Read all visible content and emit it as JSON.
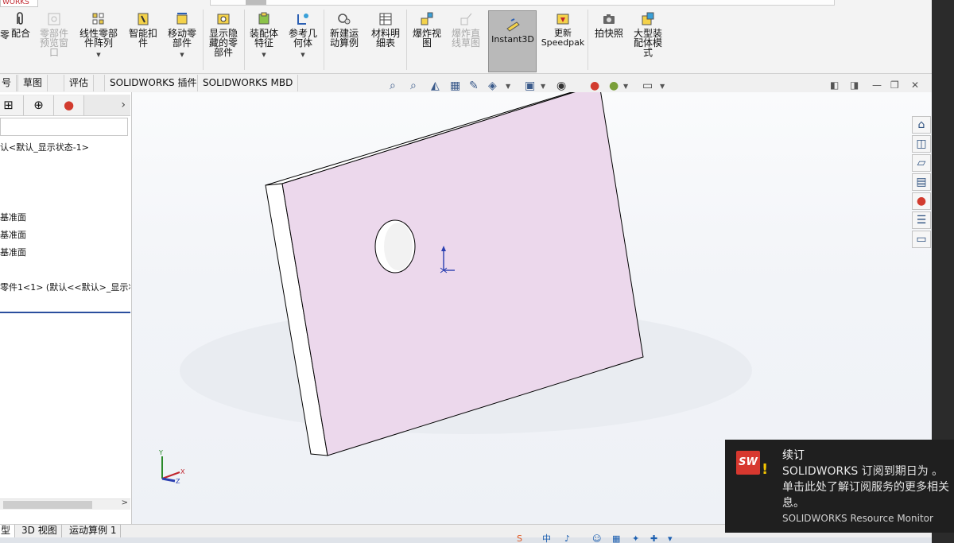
{
  "app": {
    "title_fragment": "WORKS"
  },
  "ribbon": {
    "cut_label": "零",
    "buttons": [
      {
        "key": "mate",
        "label": "配合",
        "disabled": false,
        "dropdown": false,
        "icon": "paperclip-icon"
      },
      {
        "key": "component-preview",
        "label": "零部件\n预览窗\n口",
        "disabled": true,
        "dropdown": false,
        "icon": "preview-window-icon"
      },
      {
        "key": "linear-pattern",
        "label": "线性零部\n件阵列",
        "disabled": false,
        "dropdown": true,
        "icon": "linear-pattern-icon"
      },
      {
        "key": "smart-fasteners",
        "label": "智能扣\n件",
        "disabled": false,
        "dropdown": false,
        "icon": "smart-fastener-icon"
      },
      {
        "key": "move-component",
        "label": "移动零\n部件",
        "disabled": false,
        "dropdown": true,
        "icon": "move-component-icon"
      },
      {
        "key": "show-hidden",
        "label": "显示隐\n藏的零\n部件",
        "disabled": false,
        "dropdown": false,
        "icon": "show-hidden-icon"
      },
      {
        "key": "assembly-features",
        "label": "装配体\n特征",
        "disabled": false,
        "dropdown": true,
        "icon": "assembly-feature-icon"
      },
      {
        "key": "reference-geometry",
        "label": "参考几\n何体",
        "disabled": false,
        "dropdown": true,
        "icon": "reference-geometry-icon"
      },
      {
        "key": "new-motion-study",
        "label": "新建运\n动算例",
        "disabled": false,
        "dropdown": false,
        "icon": "motion-study-icon"
      },
      {
        "key": "bill-of-materials",
        "label": "材料明\n细表",
        "disabled": false,
        "dropdown": false,
        "icon": "bom-icon"
      },
      {
        "key": "exploded-view",
        "label": "爆炸视\n图",
        "disabled": false,
        "dropdown": false,
        "icon": "exploded-view-icon"
      },
      {
        "key": "explode-line-sketch",
        "label": "爆炸直\n线草图",
        "disabled": true,
        "dropdown": false,
        "icon": "explode-line-icon"
      },
      {
        "key": "instant3d",
        "label": "Instant3D",
        "disabled": false,
        "dropdown": false,
        "icon": "instant3d-icon"
      },
      {
        "key": "update-speedpak",
        "label": "更新\nSpeedpak",
        "disabled": false,
        "dropdown": false,
        "icon": "speedpak-icon"
      },
      {
        "key": "take-snapshot",
        "label": "拍快照",
        "disabled": false,
        "dropdown": false,
        "icon": "camera-icon"
      },
      {
        "key": "large-assembly-mode",
        "label": "大型装\n配体模\n式",
        "disabled": false,
        "dropdown": false,
        "icon": "large-assembly-icon"
      }
    ]
  },
  "command_tabs": [
    {
      "label": "号"
    },
    {
      "label": "草图"
    },
    {
      "label": "评估"
    },
    {
      "label": "SOLIDWORKS 插件"
    },
    {
      "label": "SOLIDWORKS MBD"
    }
  ],
  "feature_tree": {
    "root_label": "认<默认_显示状态-1>",
    "planes": [
      "基准面",
      "基准面",
      "基准面"
    ],
    "component": "零件1<1> (默认<<默认>_显示状"
  },
  "bottom_tabs": [
    {
      "label": "型",
      "active": true
    },
    {
      "label": "3D 视图",
      "active": false
    },
    {
      "label": "运动算例 1",
      "active": false
    }
  ],
  "triad": {
    "x": "X",
    "y": "Y",
    "z": "Z"
  },
  "notification": {
    "title": "续订",
    "body": "SOLIDWORKS 订阅到期日为 。单击此处了解订阅服务的更多相关信息。",
    "body_line1": "SOLIDWORKS 订阅到期日为 。",
    "body_line2": "单击此处了解订阅服务的更多相关",
    "body_line3": "息。",
    "source": "SOLIDWORKS Resource Monitor"
  },
  "taskbar": {
    "ime": "中"
  },
  "colors": {
    "part_face": "#ecd8ec",
    "part_edge": "#000000",
    "viewport_bg": "#eef1f6",
    "instant3d_active": "#b9b9b9",
    "notification_bg": "#1f1f1f",
    "solidworks_red": "#d7382f"
  }
}
